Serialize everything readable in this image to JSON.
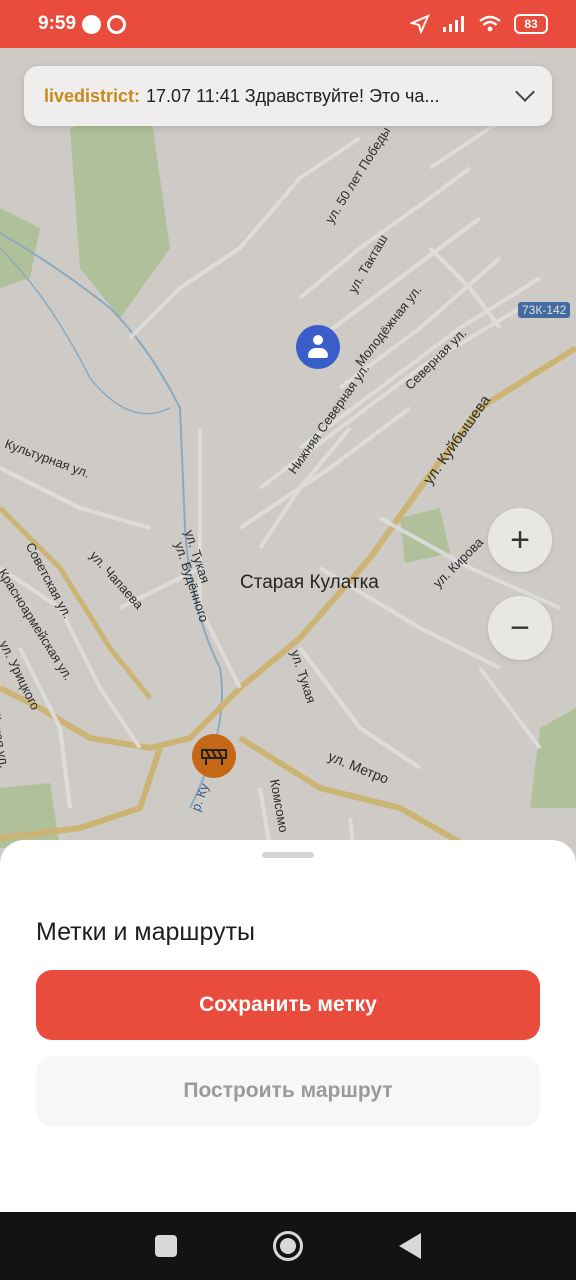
{
  "status": {
    "time": "9:59",
    "battery": "83"
  },
  "chat": {
    "author": "livedistrict:",
    "message": "17.07 11:41 Здравствуйте! Это ча..."
  },
  "map": {
    "place_name": "Старая Кулатка",
    "road_badge": "73К-142",
    "streets": {
      "pobedy": "ул. 50 лет Победы",
      "taktash": "ул. Такташ",
      "molodezhnaya": "Молодёжная ул.",
      "severnaya": "Северная ул.",
      "nizhnyaya_severnaya": "Нижняя Северная ул.",
      "kuybysheva": "ул. Куйбышева",
      "kulturnaya": "Культурная ул.",
      "tukaya_1": "ул. Тукая",
      "tukaya_2": "ул. Тукая",
      "budyonnogo": "ул. Будённого",
      "chapaeva": "ул. Чапаева",
      "sovetskaya": "Советская ул.",
      "krasnoarmeyskaya": "Красноармейская ул.",
      "uritskogo": "ул. Урицкого",
      "kirova": "ул. Кирова",
      "metro": "ул. Метро",
      "komsomolskaya": "Комсомо",
      "dzerzhinskaya": "дейская ул.",
      "river": "р. Ку"
    }
  },
  "zoom": {
    "in": "+",
    "out": "−"
  },
  "sheet": {
    "title": "Метки и маршруты",
    "save_label": "Сохранить метку",
    "route_label": "Построить маршрут"
  }
}
